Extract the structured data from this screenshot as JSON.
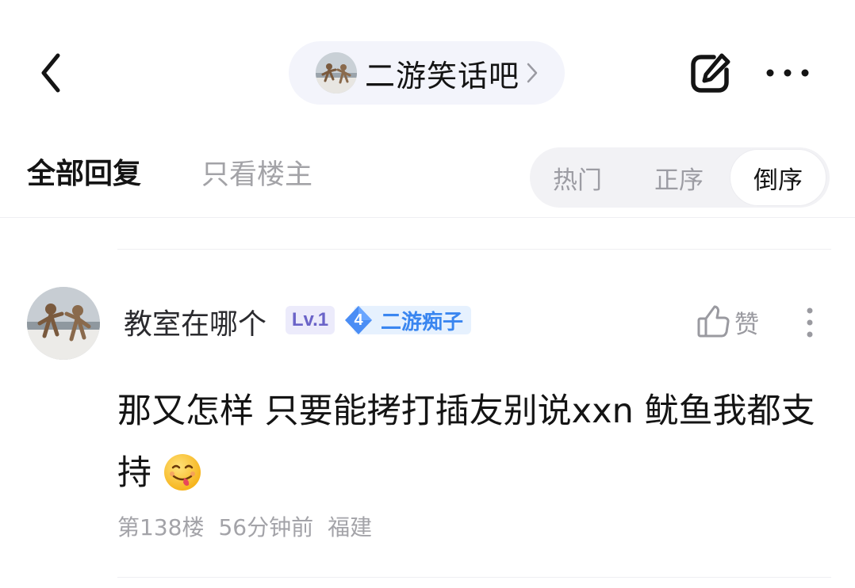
{
  "header": {
    "forum_name": "二游笑话吧",
    "icons": {
      "back": "chevron-left-icon",
      "forum_chevron": "chevron-right-icon",
      "edit": "edit-icon",
      "more": "more-horizontal-icon"
    }
  },
  "tabs": {
    "all_replies": "全部回复",
    "op_only": "只看楼主"
  },
  "sort": {
    "hot": "热门",
    "asc": "正序",
    "desc": "倒序",
    "active": "倒序"
  },
  "post": {
    "username": "教室在哪个",
    "level_badge": "Lv.1",
    "fan_badge": {
      "level": "4",
      "title": "二游痴子"
    },
    "like_label": "赞",
    "content": "那又怎样 只要能拷打插友别说xxn 鱿鱼我都支持",
    "emoji": "yum-face-emoji",
    "floor": "第138楼",
    "time": "56分钟前",
    "location": "福建"
  },
  "colors": {
    "accent_blue": "#3a86f0",
    "level_purple": "#6a63c8",
    "muted_text": "#a3a3a8",
    "pill_bg": "#f3f4fb"
  }
}
